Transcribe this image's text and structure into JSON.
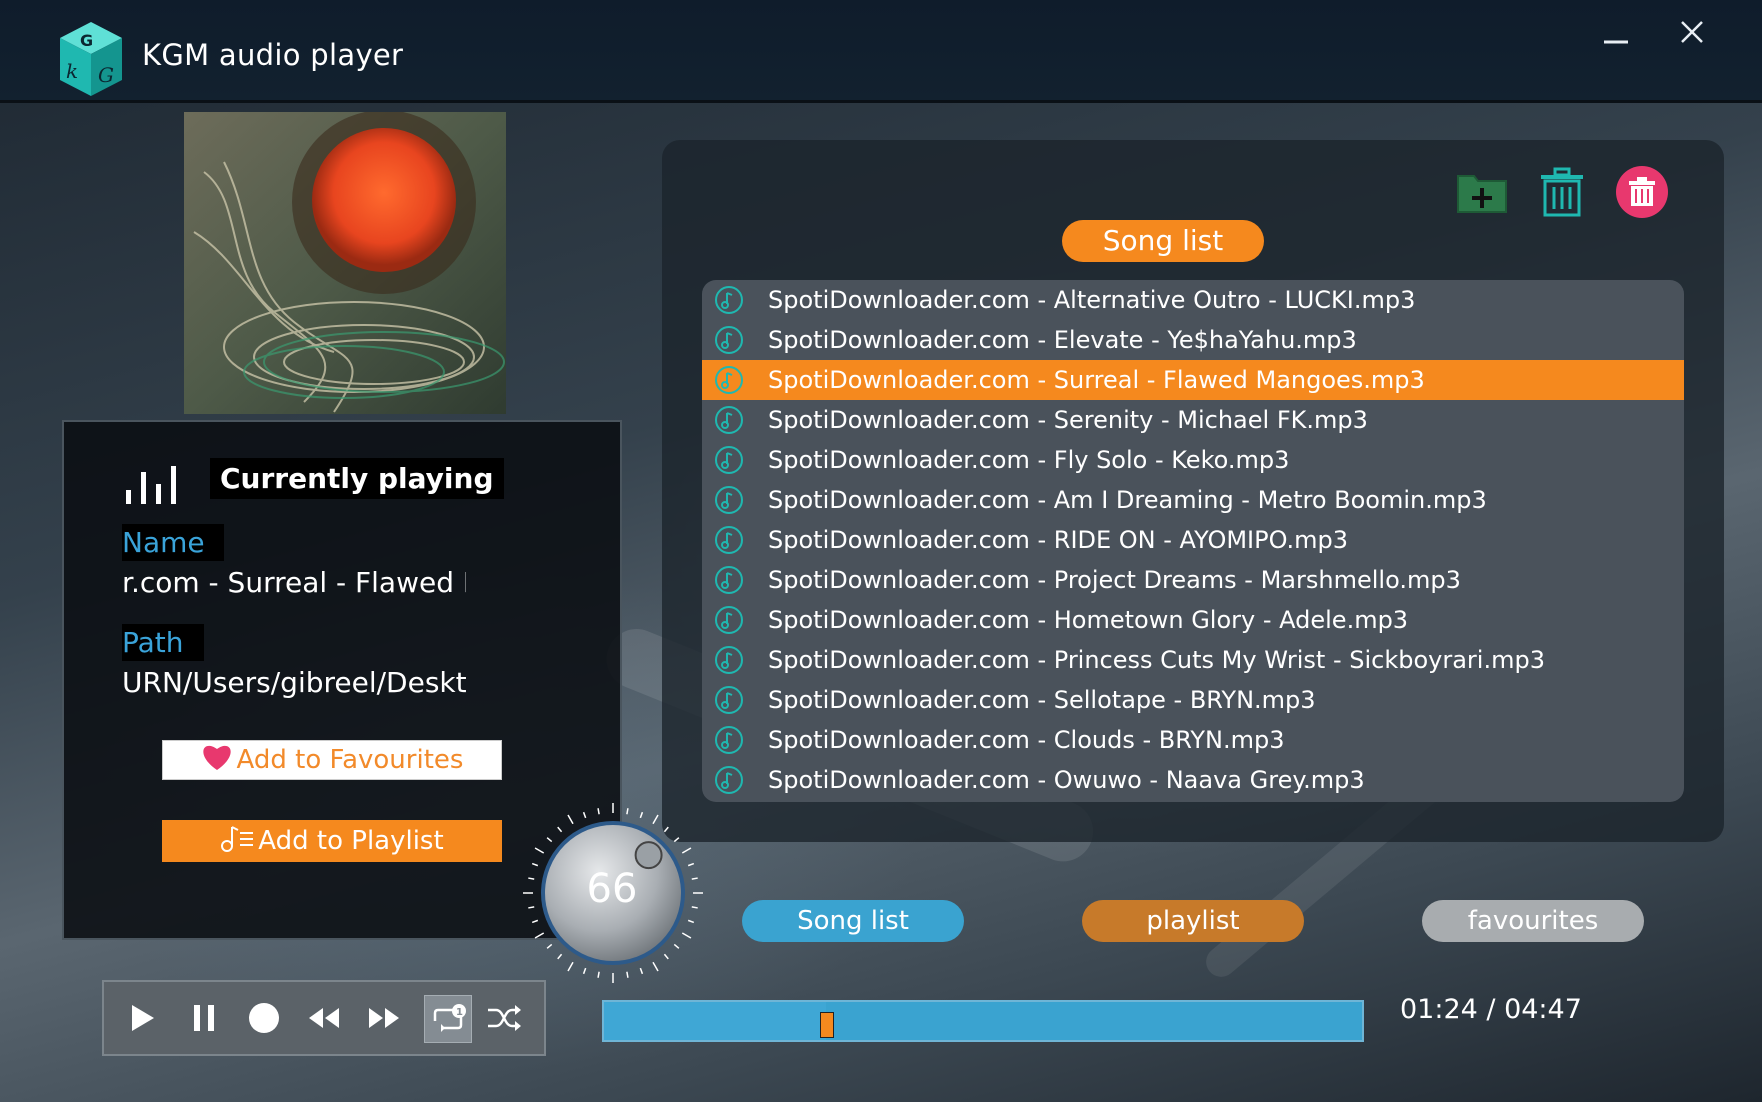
{
  "app": {
    "title": "KGM audio player"
  },
  "window": {
    "minimize_label": "—",
    "close_label": "✕"
  },
  "now_playing": {
    "heading": "Currently playing",
    "name_label": "Name",
    "name_value": "r.com - Surreal - Flawed Ma",
    "path_label": "Path",
    "path_value": "URN/Users/gibreel/Desktop"
  },
  "actions": {
    "add_favourites": "Add to Favourites",
    "add_playlist": "Add to Playlist"
  },
  "song_list": {
    "header": "Song list",
    "selected_index": 2,
    "items": [
      "SpotiDownloader.com - Alternative Outro - LUCKI.mp3",
      "SpotiDownloader.com - Elevate - Ye$haYahu.mp3",
      "SpotiDownloader.com - Surreal - Flawed Mangoes.mp3",
      "SpotiDownloader.com - Serenity - Michael FK.mp3",
      "SpotiDownloader.com - Fly Solo - Keko.mp3",
      "SpotiDownloader.com - Am I Dreaming - Metro Boomin.mp3",
      "SpotiDownloader.com - RIDE ON - AYOMIPO.mp3",
      "SpotiDownloader.com - Project Dreams - Marshmello.mp3",
      "SpotiDownloader.com - Hometown Glory - Adele.mp3",
      "SpotiDownloader.com - Princess Cuts My Wrist - Sickboyrari.mp3",
      "SpotiDownloader.com - Sellotape - BRYN.mp3",
      "SpotiDownloader.com - Clouds - BRYN.mp3",
      "SpotiDownloader.com - Owuwo - Naava Grey.mp3"
    ]
  },
  "volume": {
    "value": "66",
    "level": 0.66
  },
  "tabs": {
    "song_list": "Song list",
    "playlist": "playlist",
    "favourites": "favourites"
  },
  "playback": {
    "time": "01:24 / 04:47",
    "progress_fraction": 0.293
  },
  "icons": {
    "add_folder": "folder-plus-icon",
    "delete": "trash-icon",
    "delete_all": "trash-circle-icon",
    "play": "play-icon",
    "pause": "pause-icon",
    "stop": "stop-icon",
    "rewind": "rewind-icon",
    "forward": "fast-forward-icon",
    "repeat_one": "repeat-one-icon",
    "shuffle": "shuffle-icon"
  },
  "colors": {
    "accent_orange": "#f5891e",
    "accent_blue": "#3aa3d0",
    "tab_favourites": "#a8acaf",
    "tab_playlist": "#c77a2a",
    "delete_all_pink": "#e8386e",
    "icon_teal": "#1fb8b0"
  }
}
